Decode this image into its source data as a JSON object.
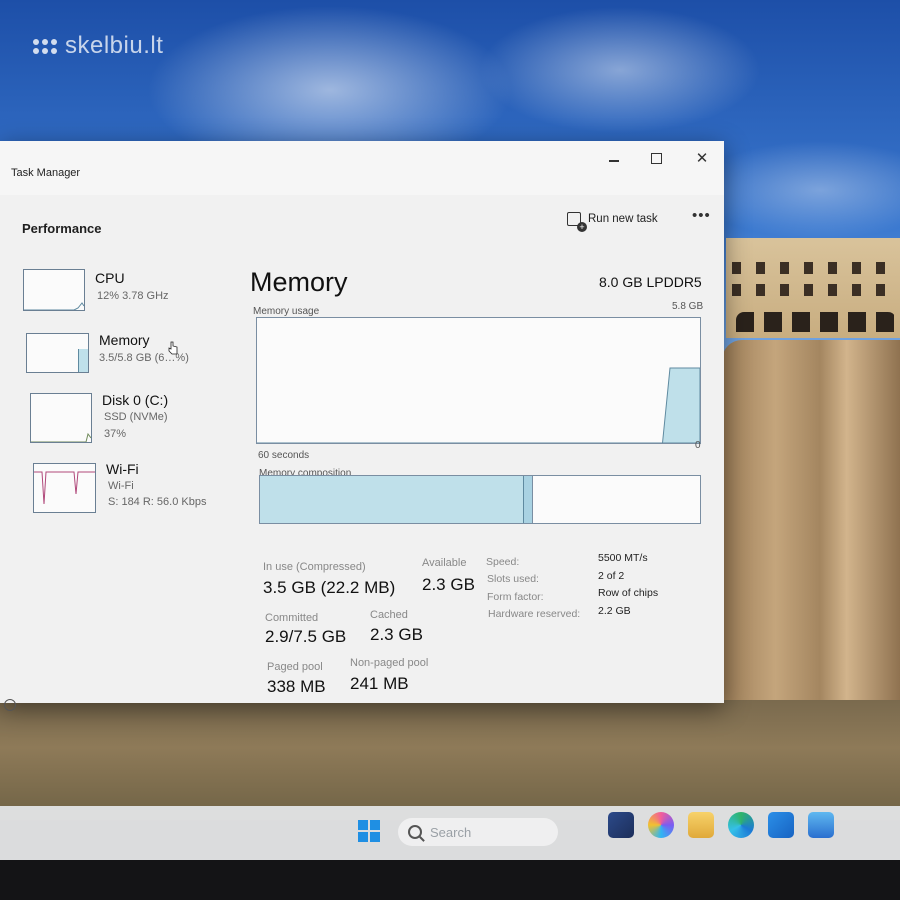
{
  "watermark": "skelbiu.lt",
  "window": {
    "title": "Task Manager",
    "page_title": "Performance",
    "run_new_task": "Run new task",
    "more_glyph": "•••"
  },
  "sidebar": {
    "items": [
      {
        "name": "CPU",
        "sub1": "12% 3.78 GHz",
        "sub2": "",
        "level": 0.12
      },
      {
        "name": "Memory",
        "sub1": "3.5/5.8 GB (6…%)",
        "sub2": "",
        "level": 0.6
      },
      {
        "name": "Disk 0 (C:)",
        "sub1": "SSD (NVMe)",
        "sub2": "37%",
        "level": 0.37
      },
      {
        "name": "Wi-Fi",
        "sub1": "Wi-Fi",
        "sub2": "S: 184 R: 56.0 Kbps",
        "level": 0.8
      }
    ]
  },
  "memory": {
    "title": "Memory",
    "spec": "8.0 GB LPDDR5",
    "usage_label": "Memory usage",
    "usage_max": "5.8 GB",
    "time_label": "60 seconds",
    "zero_label": "0",
    "composition_label": "Memory composition",
    "usage_history": [
      0,
      0,
      0,
      0,
      0,
      0,
      0,
      0,
      0,
      0,
      0,
      0,
      0,
      0,
      0,
      0,
      0,
      0,
      0,
      0,
      0,
      0,
      0,
      0,
      0,
      0,
      0,
      0,
      0,
      0,
      0,
      0,
      0,
      0,
      0,
      0,
      0,
      0,
      0,
      0,
      0,
      0,
      0,
      0,
      0,
      0,
      0,
      0,
      0,
      0,
      0,
      0,
      0,
      0,
      0,
      0.6,
      0.6,
      0.6,
      0.6,
      0.6
    ],
    "composition": {
      "in_use_fraction": 0.6,
      "modified_fraction": 0.02
    },
    "stats": {
      "in_use_label": "In use (Compressed)",
      "in_use_value": "3.5 GB (22.2 MB)",
      "available_label": "Available",
      "available_value": "2.3 GB",
      "committed_label": "Committed",
      "committed_value": "2.9/7.5 GB",
      "cached_label": "Cached",
      "cached_value": "2.3 GB",
      "paged_label": "Paged pool",
      "paged_value": "338 MB",
      "nonpaged_label": "Non-paged pool",
      "nonpaged_value": "241 MB"
    },
    "specs": [
      {
        "label": "Speed:",
        "value": "5500 MT/s"
      },
      {
        "label": "Slots used:",
        "value": "2 of 2"
      },
      {
        "label": "Form factor:",
        "value": "Row of chips"
      },
      {
        "label": "Hardware reserved:",
        "value": "2.2 GB"
      }
    ]
  },
  "taskbar": {
    "search_placeholder": "Search"
  },
  "colors": {
    "memory_fill": "#bfe0ea",
    "memory_line": "#5f8aa0",
    "wifi_line": "#b0487a"
  }
}
